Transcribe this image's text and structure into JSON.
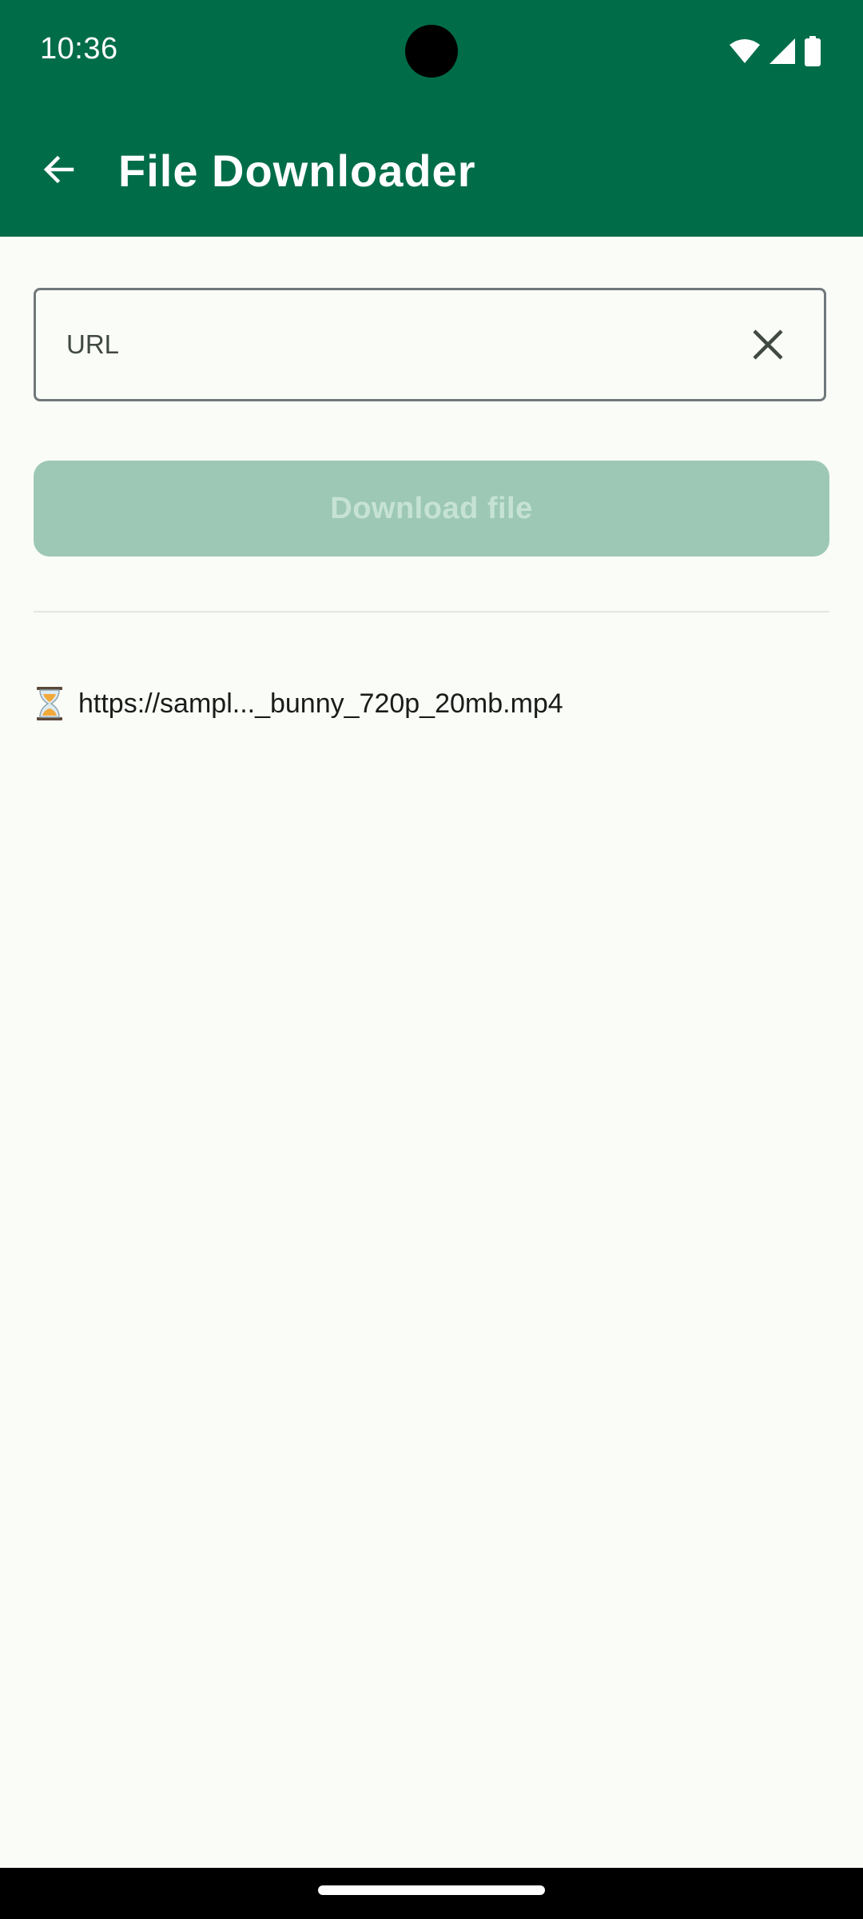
{
  "status_bar": {
    "time": "10:36",
    "icons": [
      "wifi-icon",
      "signal-icon",
      "battery-icon"
    ]
  },
  "app_bar": {
    "title": "File Downloader",
    "back_icon": "arrow-left-icon"
  },
  "url_field": {
    "placeholder": "URL",
    "value": "",
    "clear_icon": "close-icon"
  },
  "download_button": {
    "label": "Download file",
    "enabled": false
  },
  "downloads": [
    {
      "status_icon": "hourglass-icon",
      "label": "https://sampl..._bunny_720p_20mb.mp4"
    }
  ],
  "colors": {
    "primary": "#006D48",
    "background": "#FAFCF8",
    "button_disabled": "#9DC8B6",
    "button_text_disabled": "#C6E2D6",
    "text": "#1A1C1A"
  }
}
